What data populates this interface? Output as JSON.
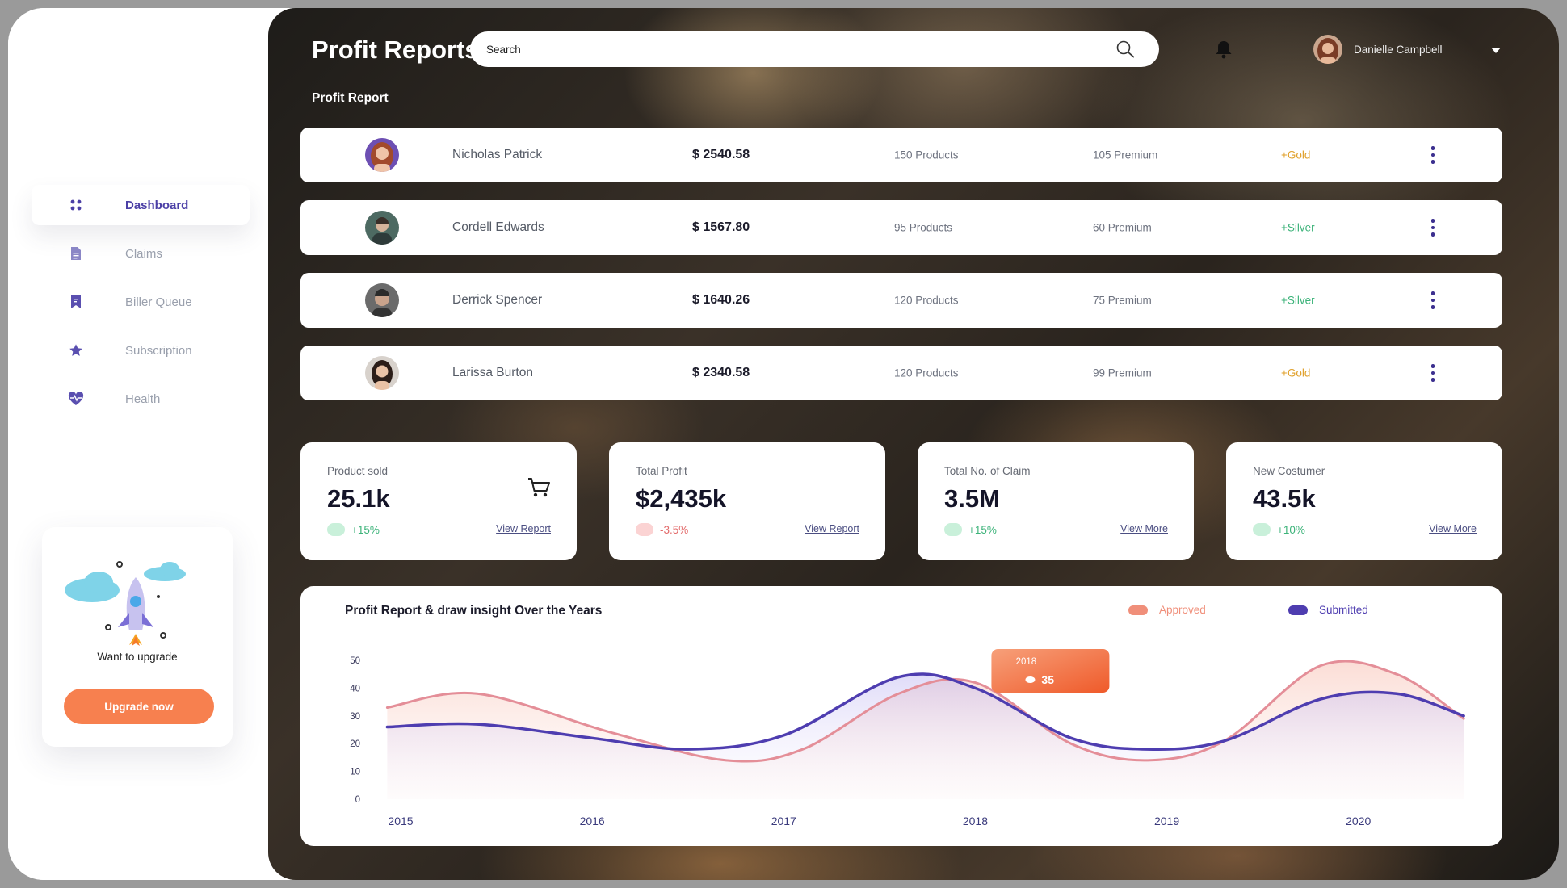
{
  "sidebar": {
    "items": [
      {
        "label": "Dashboard",
        "icon": "grid-icon",
        "active": true
      },
      {
        "label": "Claims",
        "icon": "document-icon",
        "active": false
      },
      {
        "label": "Biller Queue",
        "icon": "bookmark-icon",
        "active": false
      },
      {
        "label": "Subscription",
        "icon": "star-icon",
        "active": false
      },
      {
        "label": "Health",
        "icon": "heart-pulse-icon",
        "active": false
      }
    ],
    "upgrade": {
      "text": "Want to upgrade",
      "button_label": "Upgrade now"
    }
  },
  "header": {
    "title": "Profit Reports",
    "search_placeholder": "Search",
    "user_name": "Danielle Campbell"
  },
  "report": {
    "section_title": "Profit Report",
    "rows": [
      {
        "name": "Nicholas Patrick",
        "amount": "$ 2540.58",
        "products": "150 Products",
        "premium": "105 Premium",
        "tier": "+Gold",
        "tier_color": "#e0a02a"
      },
      {
        "name": "Cordell Edwards",
        "amount": "$ 1567.80",
        "products": "95 Products",
        "premium": "60 Premium",
        "tier": "+Silver",
        "tier_color": "#3db37a"
      },
      {
        "name": "Derrick Spencer",
        "amount": "$ 1640.26",
        "products": "120 Products",
        "premium": "75 Premium",
        "tier": "+Silver",
        "tier_color": "#3db37a"
      },
      {
        "name": "Larissa Burton",
        "amount": "$ 2340.58",
        "products": "120 Products",
        "premium": "99 Premium",
        "tier": "+Gold",
        "tier_color": "#e0a02a"
      }
    ]
  },
  "stats": [
    {
      "label": "Product sold",
      "value": "25.1k",
      "change": "+15%",
      "trend": "up",
      "link": "View Report",
      "icon": "cart-icon"
    },
    {
      "label": "Total Profit",
      "value": "$2,435k",
      "change": "-3.5%",
      "trend": "down",
      "link": "View Report"
    },
    {
      "label": "Total No. of Claim",
      "value": "3.5M",
      "change": "+15%",
      "trend": "up",
      "link": "View More"
    },
    {
      "label": "New Costumer",
      "value": "43.5k",
      "change": "+10%",
      "trend": "up",
      "link": "View More"
    }
  ],
  "colors": {
    "accent": "#4b3fa6",
    "orange": "#f7804f",
    "up": "#3db37a",
    "down": "#e36b6b",
    "approved": "#f08f7a",
    "submitted": "#4e3db0"
  },
  "chart_data": {
    "type": "line",
    "title": "Profit Report & draw insight Over the Years",
    "xlabel": "",
    "ylabel": "",
    "x_ticks": [
      "2015",
      "2016",
      "2017",
      "2018",
      "2019",
      "2020"
    ],
    "y_ticks": [
      "0",
      "10",
      "20",
      "30",
      "40",
      "50"
    ],
    "ylim": [
      0,
      50
    ],
    "xlim": [
      2015,
      2020.6
    ],
    "legend_position": "top-right",
    "series": [
      {
        "name": "Approved",
        "color": "#e48e98",
        "x": [
          2014.93,
          2015.4,
          2016.1,
          2016.7,
          2017.1,
          2017.6,
          2018.0,
          2018.5,
          2018.9,
          2019.3,
          2019.8,
          2020.2,
          2020.55
        ],
        "y": [
          33,
          38,
          24,
          14,
          18,
          38,
          42,
          20,
          14,
          21,
          48,
          45,
          29
        ]
      },
      {
        "name": "Submitted",
        "color": "#4e3db0",
        "x": [
          2014.93,
          2015.4,
          2016.0,
          2016.5,
          2017.0,
          2017.6,
          2018.0,
          2018.5,
          2018.9,
          2019.3,
          2019.8,
          2020.2,
          2020.55
        ],
        "y": [
          26,
          27,
          22,
          18,
          23,
          44,
          40,
          22,
          18,
          21,
          36,
          38,
          30
        ]
      }
    ],
    "tooltip": {
      "label": "2018",
      "value": "35"
    }
  }
}
